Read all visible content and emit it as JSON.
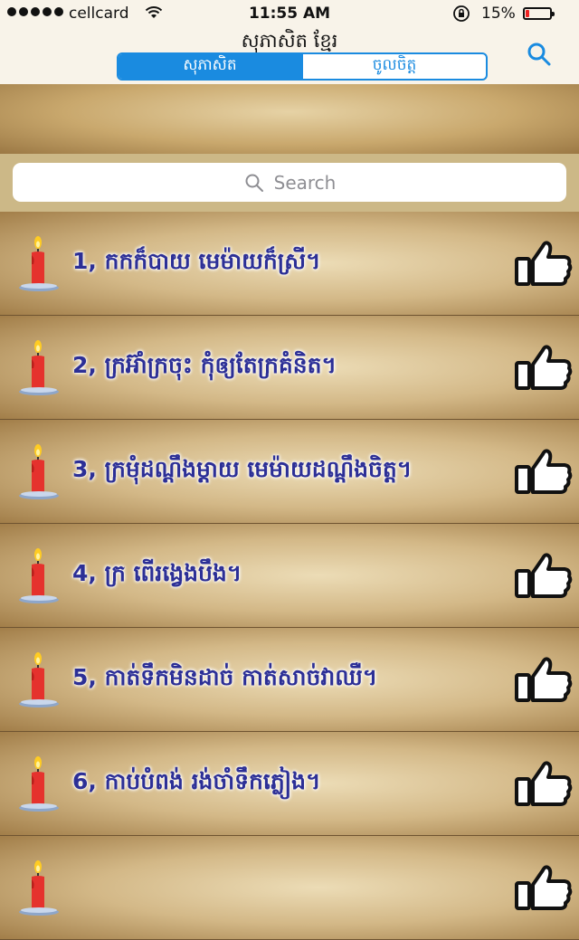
{
  "status_bar": {
    "carrier": "cellcard",
    "time": "11:55 AM",
    "battery_percent": "15%",
    "battery_level": 0.15
  },
  "nav": {
    "title": "សុភាសិត ខ្មែរ",
    "tabs": [
      {
        "label": "សុភាសិត",
        "active": true
      },
      {
        "label": "ចូលចិត្ត",
        "active": false
      }
    ],
    "accent_color": "#1a8be0"
  },
  "search": {
    "placeholder": "Search"
  },
  "proverbs": [
    {
      "text": "1, កកក៏បាយ មេម៉ាយក៏ស្រី។"
    },
    {
      "text": "2, ក្រអ៊ាំក្រចុះ កុំឲ្យតែក្រគំនិត។"
    },
    {
      "text": "3, ក្រមុំដណ្ដឹងម្ដាយ មេម៉ាយដណ្ដឹងចិត្ត។"
    },
    {
      "text": "4, ក្រ ពើរង្វេងបឹង។"
    },
    {
      "text": "5, កាត់ទឹកមិនដាច់ កាត់សាច់វាឈឺ។"
    },
    {
      "text": "6, កាប់បំពង់ រង់ចាំទឹកភ្លៀង។"
    },
    {
      "text": ""
    }
  ],
  "icons": {
    "row_icon": "candle-icon",
    "row_action": "thumbs-up-icon",
    "nav_action": "search-icon"
  }
}
